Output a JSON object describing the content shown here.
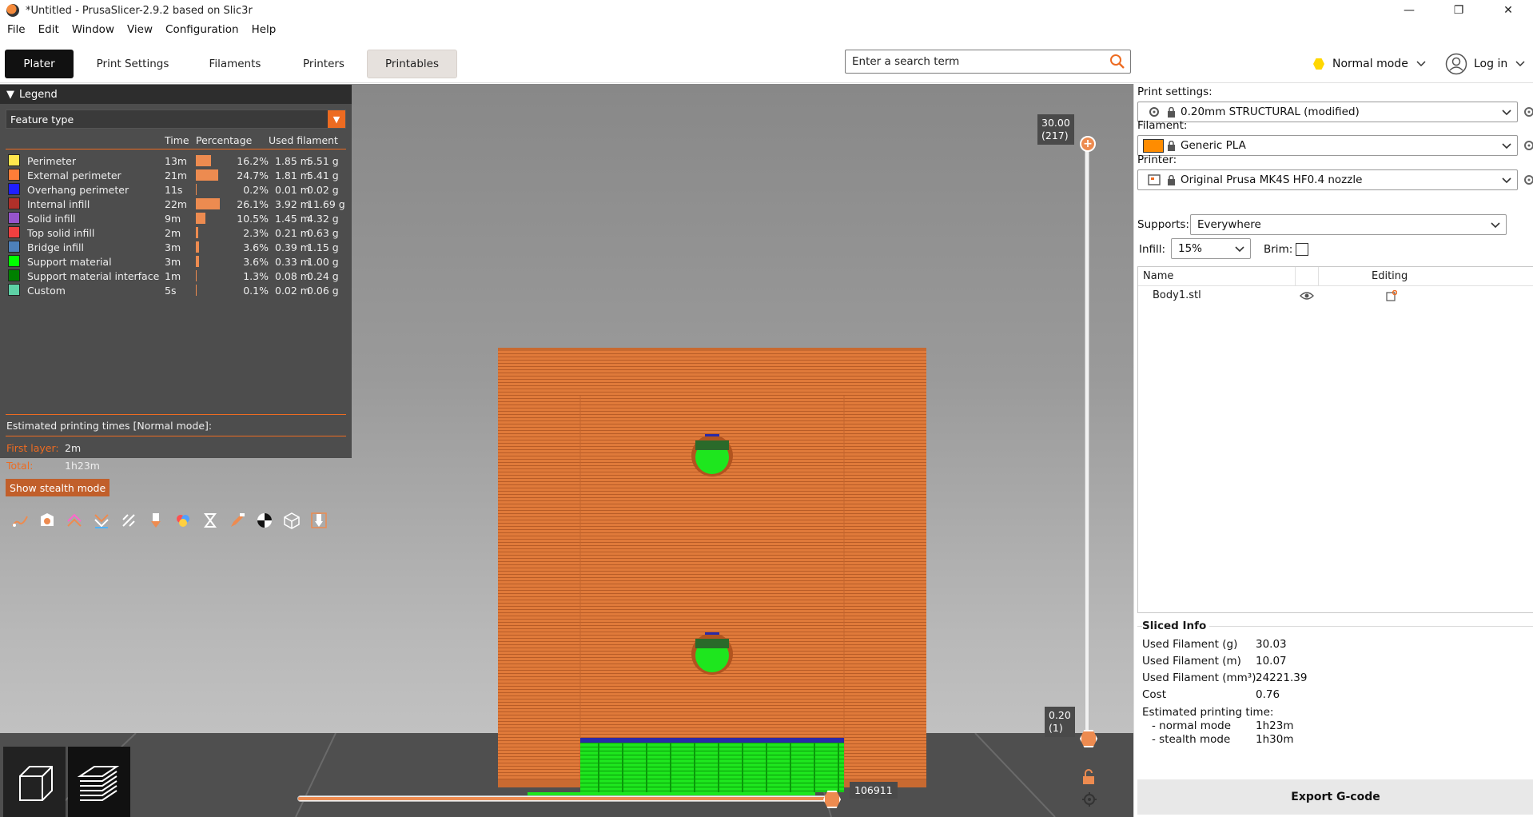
{
  "window": {
    "title": "*Untitled - PrusaSlicer-2.9.2 based on Slic3r",
    "minimize": "—",
    "maximize": "❐",
    "close": "✕"
  },
  "menu": [
    "File",
    "Edit",
    "Window",
    "View",
    "Configuration",
    "Help"
  ],
  "tabs": [
    "Plater",
    "Print Settings",
    "Filaments",
    "Printers",
    "Printables"
  ],
  "search": {
    "placeholder": "Enter a search term"
  },
  "mode": {
    "label": "Normal mode",
    "color": "#ffd700"
  },
  "login": {
    "label": "Log in"
  },
  "legend": {
    "title": "Legend",
    "view_type": "Feature type",
    "columns": {
      "time": "Time",
      "percentage": "Percentage",
      "filament": "Used filament"
    },
    "rows": [
      {
        "name": "Perimeter",
        "color": "#ffe64d",
        "time": "13m",
        "percent": 16.2,
        "percent_label": "16.2%",
        "m": "1.85 m",
        "g": "5.51 g"
      },
      {
        "name": "External perimeter",
        "color": "#ff7d38",
        "time": "21m",
        "percent": 24.7,
        "percent_label": "24.7%",
        "m": "1.81 m",
        "g": "5.41 g"
      },
      {
        "name": "Overhang perimeter",
        "color": "#1f1fff",
        "time": "11s",
        "percent": 0.2,
        "percent_label": "0.2%",
        "m": "0.01 m",
        "g": "0.02 g"
      },
      {
        "name": "Internal infill",
        "color": "#b03029",
        "time": "22m",
        "percent": 26.1,
        "percent_label": "26.1%",
        "m": "3.92 m",
        "g": "11.69 g"
      },
      {
        "name": "Solid infill",
        "color": "#9654cc",
        "time": "9m",
        "percent": 10.5,
        "percent_label": "10.5%",
        "m": "1.45 m",
        "g": "4.32 g"
      },
      {
        "name": "Top solid infill",
        "color": "#f04040",
        "time": "2m",
        "percent": 2.3,
        "percent_label": "2.3%",
        "m": "0.21 m",
        "g": "0.63 g"
      },
      {
        "name": "Bridge infill",
        "color": "#4d80ba",
        "time": "3m",
        "percent": 3.6,
        "percent_label": "3.6%",
        "m": "0.39 m",
        "g": "1.15 g"
      },
      {
        "name": "Support material",
        "color": "#00ff00",
        "time": "3m",
        "percent": 3.6,
        "percent_label": "3.6%",
        "m": "0.33 m",
        "g": "1.00 g"
      },
      {
        "name": "Support material interface",
        "color": "#008000",
        "time": "1m",
        "percent": 1.3,
        "percent_label": "1.3%",
        "m": "0.08 m",
        "g": "0.24 g"
      },
      {
        "name": "Custom",
        "color": "#5ed1a6",
        "time": "5s",
        "percent": 0.1,
        "percent_label": "0.1%",
        "m": "0.02 m",
        "g": "0.06 g"
      }
    ],
    "estimated_title": "Estimated printing times [Normal mode]:",
    "first_layer_label": "First layer:",
    "first_layer_value": "2m",
    "total_label": "Total:",
    "total_value": "1h23m",
    "stealth_button": "Show stealth mode"
  },
  "vslider": {
    "top_value": "30.00",
    "top_layer": "(217)",
    "bottom_value": "0.20",
    "bottom_layer": "(1)"
  },
  "hslider": {
    "value": "106911"
  },
  "right": {
    "print_label": "Print settings:",
    "print_value": "0.20mm STRUCTURAL (modified)",
    "filament_label": "Filament:",
    "filament_value": "Generic PLA",
    "filament_color": "#ff8c00",
    "printer_label": "Printer:",
    "printer_value": "Original Prusa MK4S HF0.4 nozzle",
    "supports_label": "Supports:",
    "supports_value": "Everywhere",
    "infill_label": "Infill:",
    "infill_value": "15%",
    "brim_label": "Brim:",
    "objects": {
      "col_name": "Name",
      "col_editing": "Editing",
      "items": [
        "Body1.stl"
      ]
    },
    "sliced_info": {
      "title": "Sliced Info",
      "rows": [
        {
          "label": "Used Filament (g)",
          "value": "30.03"
        },
        {
          "label": "Used Filament (m)",
          "value": "10.07"
        },
        {
          "label": "Used Filament (mm³)",
          "value": "24221.39"
        },
        {
          "label": "Cost",
          "value": "0.76"
        }
      ],
      "est_label": "Estimated printing time:",
      "normal_label": "- normal mode",
      "normal_value": "1h23m",
      "stealth_label": "- stealth mode",
      "stealth_value": "1h30m"
    },
    "export_button": "Export G-code"
  }
}
